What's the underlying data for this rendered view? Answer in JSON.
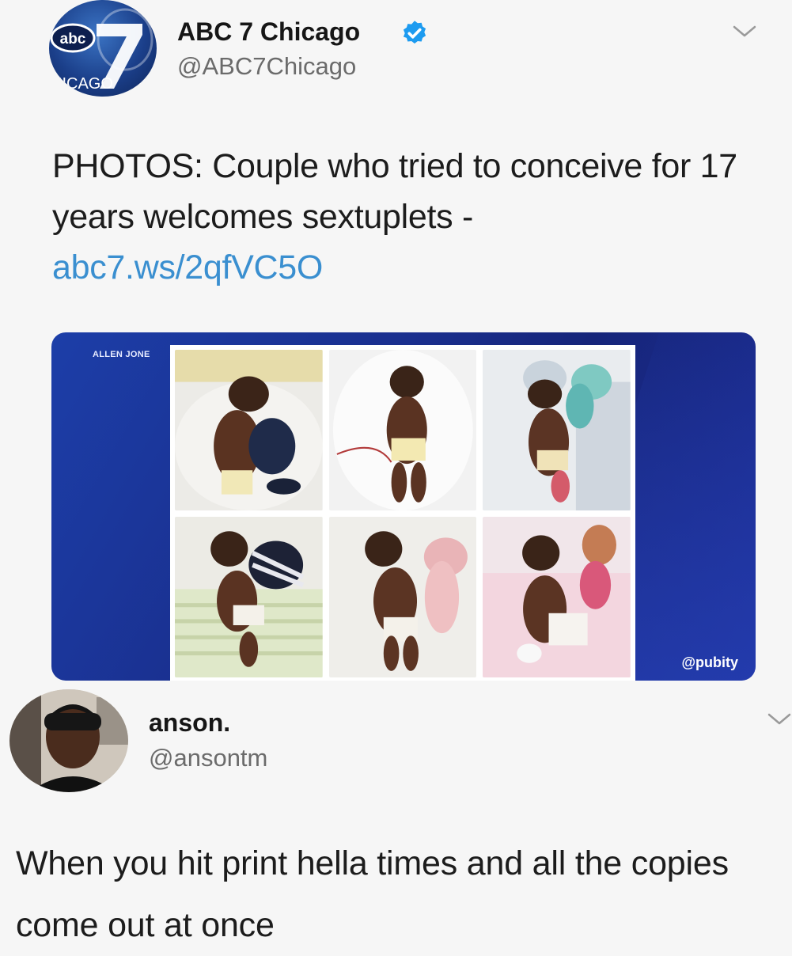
{
  "tweet1": {
    "display_name": "ABC 7 Chicago",
    "handle": "@ABC7Chicago",
    "avatar": {
      "logo_abc": "abc",
      "logo_number": "7",
      "logo_city": "HICAGO"
    },
    "verified_icon": "verified-badge-icon",
    "menu_icon": "chevron-down-icon",
    "text_before_link": "PHOTOS: Couple who tried to conceive for 17 years welcomes sextuplets - ",
    "link": "abc7.ws/2qfVC5O",
    "media": {
      "credit": "ALLEN JONE",
      "watermark": "@pubity",
      "photo_count": 6
    }
  },
  "tweet2": {
    "display_name": "anson.",
    "handle": "@ansontm",
    "menu_icon": "chevron-down-icon",
    "text": "When you hit print hella times and all the copies come out at once"
  },
  "colors": {
    "background": "#f6f6f6",
    "link": "#3a8fd0",
    "verified": "#1d9bf0",
    "media_blue": "#1a2f8e"
  }
}
